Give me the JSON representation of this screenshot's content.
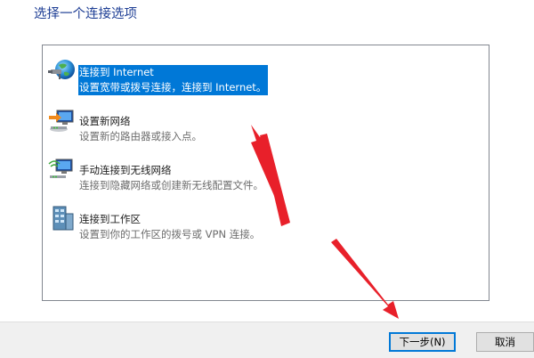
{
  "page": {
    "title": "选择一个连接选项"
  },
  "options": [
    {
      "title": "连接到 Internet",
      "desc": "设置宽带或拨号连接，连接到 Internet。",
      "icon": "globe-network-icon",
      "selected": true
    },
    {
      "title": "设置新网络",
      "desc": "设置新的路由器或接入点。",
      "icon": "router-setup-icon",
      "selected": false
    },
    {
      "title": "手动连接到无线网络",
      "desc": "连接到隐藏网络或创建新无线配置文件。",
      "icon": "wireless-network-icon",
      "selected": false
    },
    {
      "title": "连接到工作区",
      "desc": "设置到你的工作区的拨号或 VPN 连接。",
      "icon": "workplace-vpn-icon",
      "selected": false
    }
  ],
  "buttons": {
    "next": "下一步(N)",
    "cancel": "取消"
  },
  "colors": {
    "title": "#1f3f95",
    "selection": "#0078d7",
    "annotation_arrow": "#e8202a"
  }
}
